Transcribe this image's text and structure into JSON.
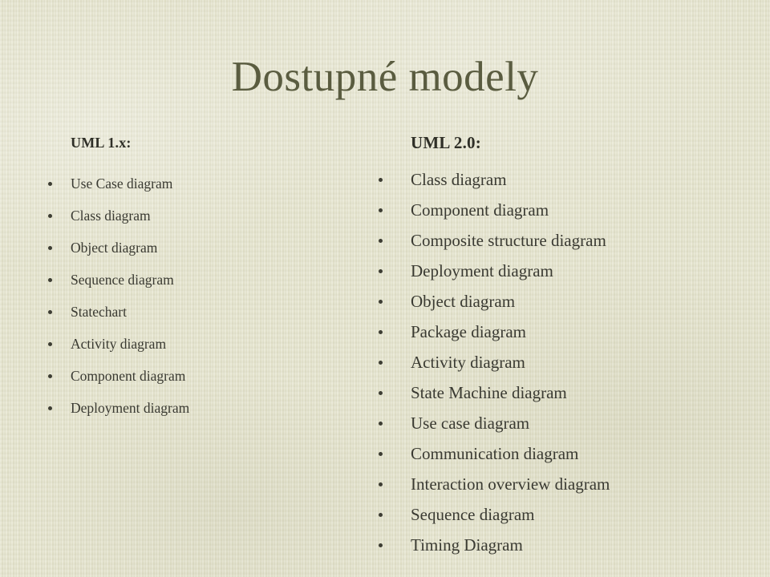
{
  "slide": {
    "title": "Dostupné modely",
    "background_color": "#e4e3cc",
    "title_color": "#5a5c40",
    "text_color": "#3a3a32"
  },
  "columns": {
    "left": {
      "heading": "UML 1.x:",
      "items": [
        "Use Case diagram",
        "Class diagram",
        "Object diagram",
        "Sequence diagram",
        "Statechart",
        "Activity diagram",
        "Component diagram",
        "Deployment diagram"
      ]
    },
    "right": {
      "heading": "UML 2.0:",
      "items": [
        "Class diagram",
        "Component diagram",
        "Composite structure diagram",
        "Deployment diagram",
        "Object diagram",
        "Package diagram",
        "Activity diagram",
        "State Machine diagram",
        "Use case diagram",
        "Communication diagram",
        "Interaction overview diagram",
        "Sequence diagram",
        "Timing Diagram"
      ]
    }
  }
}
